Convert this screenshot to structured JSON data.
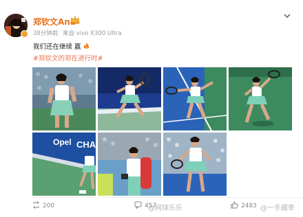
{
  "post": {
    "author": "郑钦文Ana",
    "time": "38分钟前",
    "source": "来自 vivo X300 Ultra",
    "text": "我们还在继续 赢",
    "topic": "#郑钦文的郑在进行时#"
  },
  "actions": {
    "reposts": "200",
    "comments": "457",
    "likes": "2483"
  },
  "watermarks": {
    "left": "@网球乐乐",
    "right": "@一手藏季"
  },
  "photos": [
    {
      "scene": "player-standing-arena",
      "court": "#4a8a5a"
    },
    {
      "scene": "player-running-blue-court",
      "court": "#1d3c8f"
    },
    {
      "scene": "player-forehand-blue-court",
      "court": "#2a63b8"
    },
    {
      "scene": "player-swing-green-court",
      "court": "#3d8a5e"
    },
    {
      "scene": "player-lunge-blue-wall",
      "court": "#1e4fa0"
    },
    {
      "scene": "player-with-bag",
      "court": "#6aa0c8"
    },
    {
      "scene": "player-forehand-crowd",
      "court": "#2a63b8"
    }
  ],
  "colors": {
    "accent": "#e8731f",
    "topic": "#eb7350",
    "muted": "#999999"
  }
}
